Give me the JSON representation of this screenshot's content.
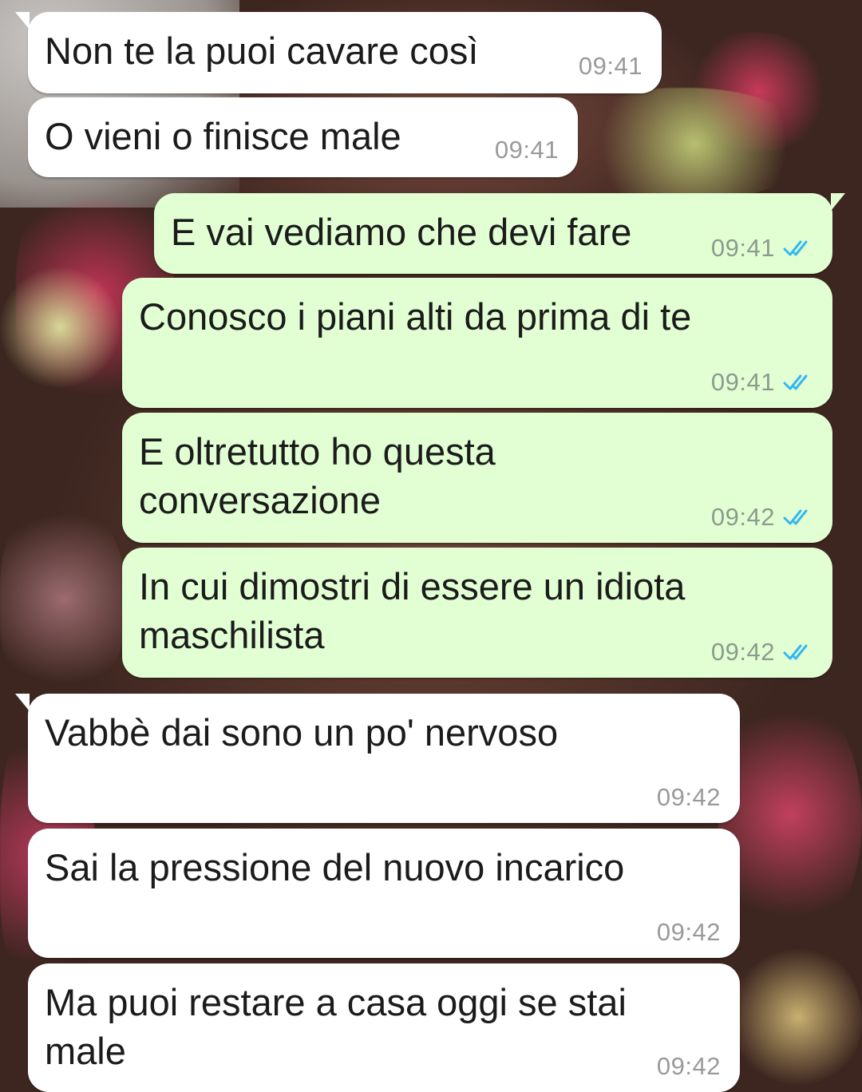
{
  "colors": {
    "incoming_bubble": "#ffffff",
    "outgoing_bubble": "#e2ffd4",
    "read_ticks": "#34b7f1",
    "time_text": "#8d9a8d"
  },
  "messages": [
    {
      "direction": "incoming",
      "text": "Non te la puoi cavare così",
      "time": "09:41"
    },
    {
      "direction": "incoming",
      "text": "O vieni o finisce male",
      "time": "09:41"
    },
    {
      "direction": "outgoing",
      "text": "E vai vediamo che devi fare",
      "time": "09:41",
      "status": "read-double-check-icon"
    },
    {
      "direction": "outgoing",
      "text": "Conosco i piani alti da prima di te",
      "time": "09:41",
      "status": "read-double-check-icon"
    },
    {
      "direction": "outgoing",
      "text": "E oltretutto ho questa\nconversazione",
      "time": "09:42",
      "status": "read-double-check-icon"
    },
    {
      "direction": "outgoing",
      "text": "In cui dimostri di essere un idiota\nmaschilista",
      "time": "09:42",
      "status": "read-double-check-icon"
    },
    {
      "direction": "incoming",
      "text": "Vabbè dai sono un po' nervoso",
      "time": "09:42"
    },
    {
      "direction": "incoming",
      "text": "Sai la pressione del nuovo incarico",
      "time": "09:42"
    },
    {
      "direction": "incoming",
      "text": "Ma puoi restare a casa oggi se stai\nmale",
      "time": "09:42"
    }
  ]
}
